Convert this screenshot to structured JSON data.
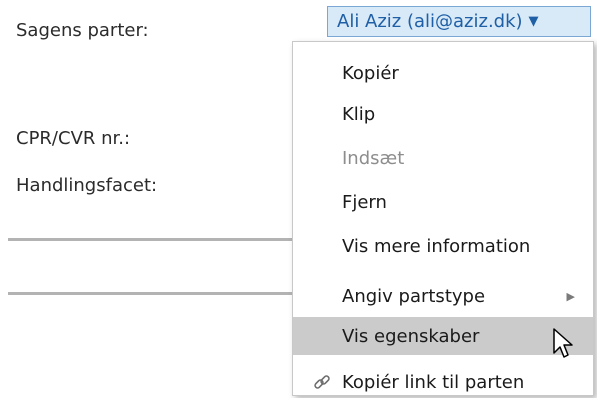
{
  "form": {
    "parties_label": "Sagens parter:",
    "cpr_label": "CPR/CVR nr.:",
    "facet_label": "Handlingsfacet:"
  },
  "party_select": {
    "value": "Ali Aziz (ali@aziz.dk)",
    "icon": "triangle-down-icon"
  },
  "context_menu": {
    "items": [
      {
        "label": "Kopiér",
        "enabled": true
      },
      {
        "label": "Klip",
        "enabled": true
      },
      {
        "label": "Indsæt",
        "enabled": false
      },
      {
        "label": "Fjern",
        "enabled": true
      },
      {
        "label": "Vis mere information",
        "enabled": true
      },
      {
        "label": "Angiv partstype",
        "enabled": true,
        "submenu": true
      },
      {
        "label": "Vis egenskaber",
        "enabled": true,
        "highlighted": true
      },
      {
        "label": "Kopiér link til parten",
        "enabled": true,
        "icon": "link-icon"
      }
    ]
  },
  "colors": {
    "select_background": "#d8e9f8",
    "select_text": "#1f5fa5",
    "highlight": "#cbcbcb",
    "disabled_text": "#8d8d8d"
  }
}
